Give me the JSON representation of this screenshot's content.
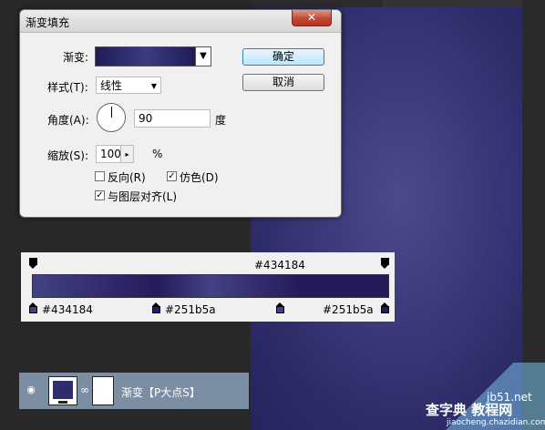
{
  "dialog": {
    "title": "渐变填充",
    "close_label": "✕",
    "gradient_label": "渐变:",
    "style_label": "样式(T):",
    "style_value": "线性",
    "angle_label": "角度(A):",
    "angle_value": "90",
    "angle_unit": "度",
    "scale_label": "缩放(S):",
    "scale_value": "100",
    "scale_unit": "%",
    "reverse_label": "反向(R)",
    "reverse_checked": false,
    "dither_label": "仿色(D)",
    "dither_checked": true,
    "align_label": "与图层对齐(L)",
    "align_checked": true,
    "ok_label": "确定",
    "cancel_label": "取消"
  },
  "gradient_editor": {
    "top_stop_label": "#434184",
    "bottom_stops": [
      "#434184",
      "#251b5a",
      "#251b5a"
    ]
  },
  "layer": {
    "name": "渐变【P大点S】"
  },
  "watermark": {
    "url": "jb51.net",
    "main": "查字典 教程网",
    "sub": "jiaocheng.chazidian.com"
  },
  "icons": {
    "eye": "eye-icon",
    "link": "chain-link-icon",
    "dropdown": "chevron-down-icon"
  },
  "colors": {
    "gradient_light": "#434184",
    "gradient_dark": "#251b5a",
    "layer_row": "#7b8ea4"
  }
}
